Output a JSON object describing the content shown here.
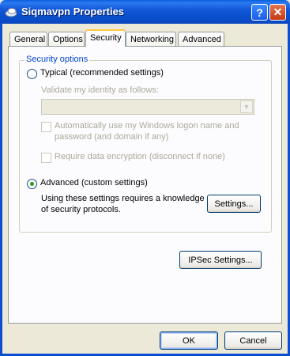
{
  "window": {
    "title": "Siqmavpn Properties",
    "help_symbol": "?",
    "close_symbol": "✕"
  },
  "tabs": [
    {
      "label": "General"
    },
    {
      "label": "Options"
    },
    {
      "label": "Security"
    },
    {
      "label": "Networking"
    },
    {
      "label": "Advanced"
    }
  ],
  "active_tab": "Security",
  "security_options": {
    "legend": "Security options",
    "typical_label": "Typical (recommended settings)",
    "typical_selected": false,
    "validate_label": "Validate my identity as follows:",
    "validate_value": "",
    "auto_logon_label_line1": "Automatically use my Windows logon name and",
    "auto_logon_label_line2": "password (and domain if any)",
    "auto_logon_checked": false,
    "require_encryption_label": "Require data encryption (disconnect if none)",
    "require_encryption_checked": false,
    "advanced_label": "Advanced (custom settings)",
    "advanced_selected": true,
    "advanced_desc_line1": "Using these settings requires a knowledge",
    "advanced_desc_line2": "of security protocols.",
    "settings_button": "Settings..."
  },
  "ipsec_button": "IPSec Settings...",
  "footer": {
    "ok_label": "OK",
    "cancel_label": "Cancel"
  },
  "colors": {
    "titlebar": "#0a4fcc",
    "dialog_bg": "#ece9d8",
    "legend_text": "#0046d5",
    "active_tab_accent": "#ffc83c",
    "radio_dot": "#21a121"
  }
}
